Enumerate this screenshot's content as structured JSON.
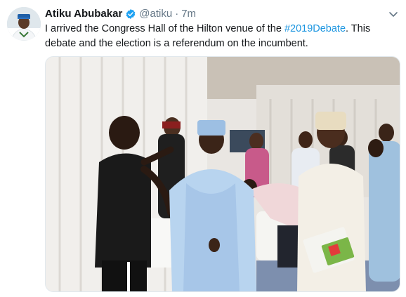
{
  "tweet": {
    "author_name": "Atiku Abubakar",
    "handle": "@atiku",
    "separator": "·",
    "timestamp": "7m",
    "text_parts": [
      "I arrived the Congress Hall of the Hilton venue of the ",
      "#2019Debate",
      ". This debate and the election is a referendum on the incumbent."
    ],
    "verified_icon": "verified-badge-icon",
    "menu_icon": "chevron-down-icon"
  },
  "colors": {
    "accent": "#1b95e0",
    "secondary_text": "#657786",
    "primary_text": "#14171a"
  }
}
